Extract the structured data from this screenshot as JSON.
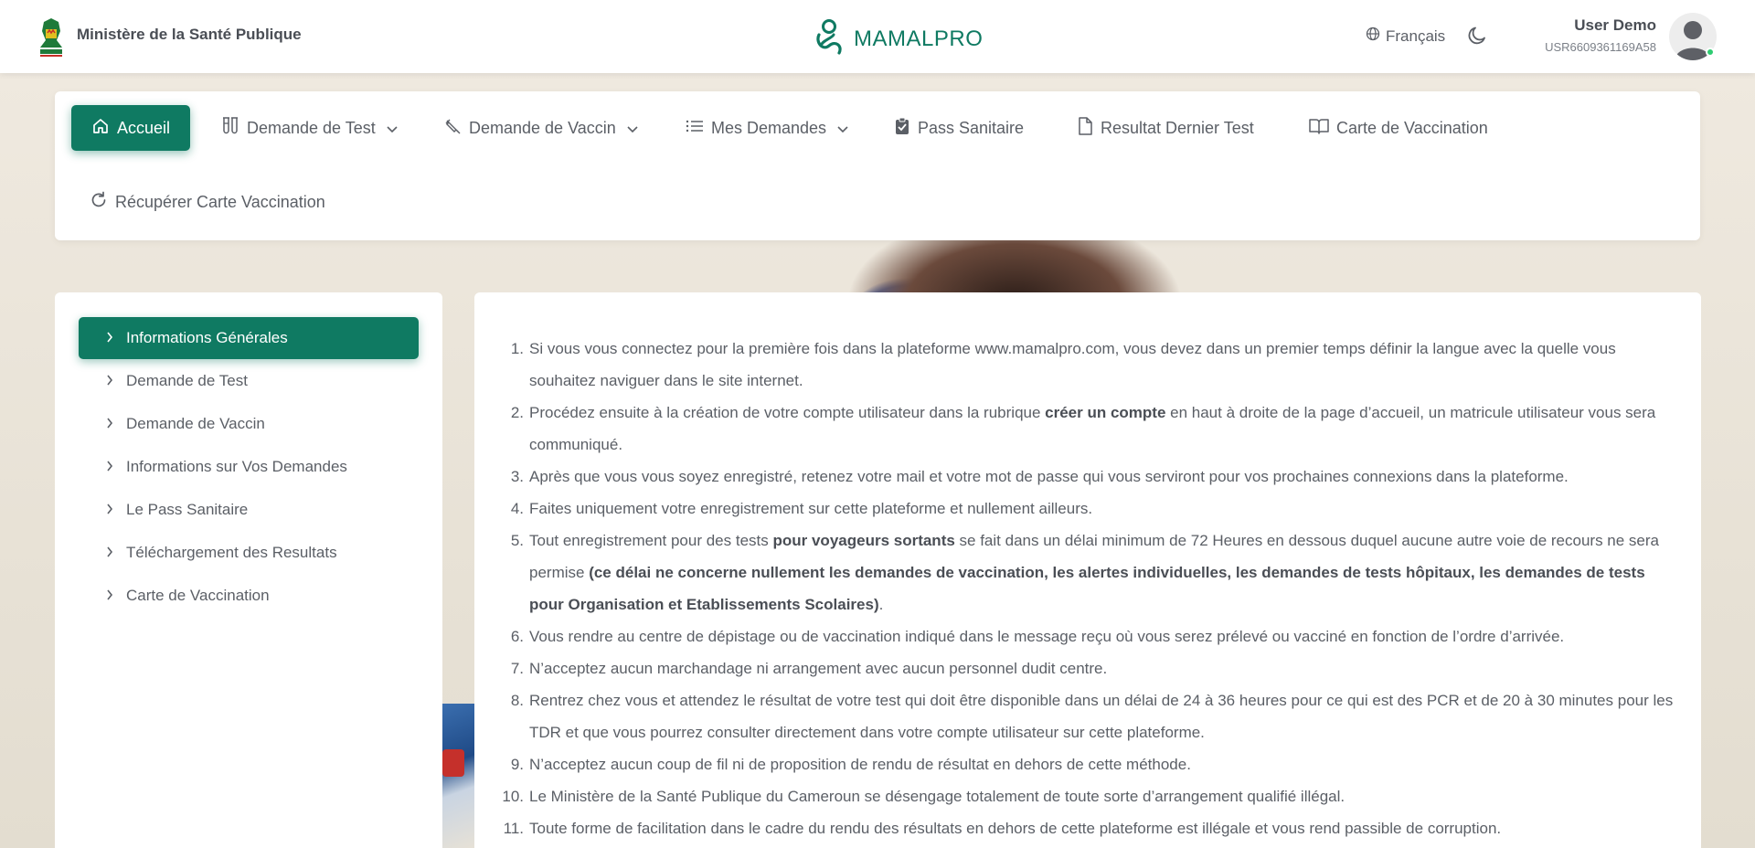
{
  "header": {
    "ministry_name": "Ministère de la Santé Publique",
    "brand_name": "MAMALPRO",
    "language": "Français",
    "user_name": "User Demo",
    "user_id": "USR6609361169A58"
  },
  "nav": {
    "items": [
      {
        "label": "Accueil",
        "icon": "home-icon",
        "active": true
      },
      {
        "label": "Demande de Test",
        "icon": "test-tubes-icon",
        "dropdown": true
      },
      {
        "label": "Demande de Vaccin",
        "icon": "syringe-icon",
        "dropdown": true
      },
      {
        "label": "Mes Demandes",
        "icon": "list-icon",
        "dropdown": true
      },
      {
        "label": "Pass Sanitaire",
        "icon": "clipboard-check-icon"
      },
      {
        "label": "Resultat Dernier Test",
        "icon": "file-icon"
      },
      {
        "label": "Carte de Vaccination",
        "icon": "book-open-icon"
      },
      {
        "label": "Récupérer Carte Vaccination",
        "icon": "refresh-icon"
      }
    ]
  },
  "sidebar": {
    "items": [
      {
        "label": "Informations Générales",
        "active": true
      },
      {
        "label": "Demande de Test"
      },
      {
        "label": "Demande de Vaccin"
      },
      {
        "label": "Informations sur Vos Demandes"
      },
      {
        "label": "Le Pass Sanitaire"
      },
      {
        "label": "Téléchargement des Resultats"
      },
      {
        "label": "Carte de Vaccination"
      }
    ]
  },
  "content": {
    "rules": [
      {
        "num": "1.",
        "parts": [
          {
            "t": "Si vous vous connectez pour la première fois dans la plateforme www.mamalpro.com, vous devez dans un premier temps définir la langue avec la quelle vous souhaitez naviguer dans le site internet."
          }
        ]
      },
      {
        "num": "2.",
        "parts": [
          {
            "t": "Procédez ensuite à la création de votre compte utilisateur dans la rubrique "
          },
          {
            "t": "créer un compte",
            "b": true
          },
          {
            "t": " en haut à droite de la page d’accueil, un matricule utilisateur vous sera communiqué."
          }
        ]
      },
      {
        "num": "3.",
        "parts": [
          {
            "t": "Après que vous vous soyez enregistré, retenez votre mail et votre mot de passe qui vous serviront pour vos prochaines connexions dans la plateforme."
          }
        ]
      },
      {
        "num": "4.",
        "parts": [
          {
            "t": "Faites uniquement votre enregistrement sur cette plateforme et nullement ailleurs."
          }
        ]
      },
      {
        "num": "5.",
        "parts": [
          {
            "t": "Tout enregistrement pour des tests "
          },
          {
            "t": "pour voyageurs sortants",
            "b": true
          },
          {
            "t": " se fait dans un délai minimum de 72 Heures en dessous duquel aucune autre voie de recours ne sera permise "
          },
          {
            "t": "(ce délai ne concerne nullement les demandes de vaccination, les alertes individuelles, les demandes de tests hôpitaux, les demandes de tests pour Organisation et Etablissements Scolaires)",
            "b": true
          },
          {
            "t": "."
          }
        ]
      },
      {
        "num": "6.",
        "parts": [
          {
            "t": "Vous rendre au centre de dépistage ou de vaccination indiqué dans le message reçu où vous serez prélevé ou vacciné en fonction de l’ordre d’arrivée."
          }
        ]
      },
      {
        "num": "7.",
        "parts": [
          {
            "t": "N’acceptez aucun marchandage ni arrangement avec aucun personnel dudit centre."
          }
        ]
      },
      {
        "num": "8.",
        "parts": [
          {
            "t": "Rentrez chez vous et attendez le résultat de votre test qui doit être disponible dans un délai de 24 à 36 heures pour ce qui est des PCR et de 20 à 30 minutes pour les TDR et que vous pourrez consulter directement dans votre compte utilisateur sur cette plateforme."
          }
        ]
      },
      {
        "num": "9.",
        "parts": [
          {
            "t": "N’acceptez aucun coup de fil ni de proposition de rendu de résultat en dehors de cette méthode."
          }
        ]
      },
      {
        "num": "10.",
        "parts": [
          {
            "t": "Le Ministère de la Santé Publique du Cameroun se désengage totalement de toute sorte d’arrangement qualifié illégal."
          }
        ]
      },
      {
        "num": "11.",
        "parts": [
          {
            "t": "Toute forme de facilitation dans le cadre du rendu des résultats en dehors de cette plateforme est illégale et vous rend passible de corruption."
          }
        ]
      }
    ]
  },
  "colors": {
    "accent": "#0f7a62",
    "text": "#5b5f66"
  }
}
